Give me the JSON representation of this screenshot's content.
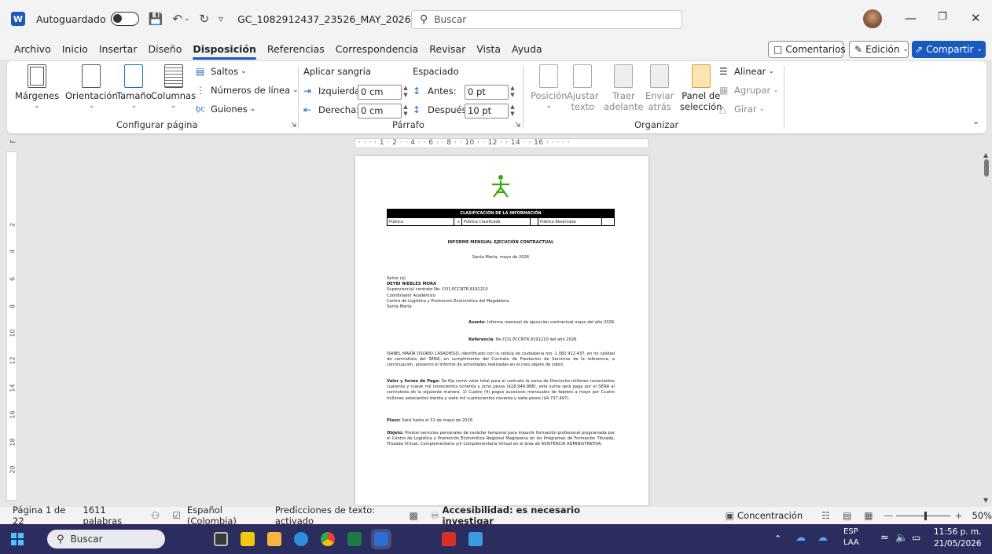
{
  "titlebar": {
    "autosave_label": "Autoguardado",
    "doc_title": "GC_1082912437_23526_MAY_2026....",
    "search_placeholder": "Buscar"
  },
  "menu": {
    "tabs": [
      "Archivo",
      "Inicio",
      "Insertar",
      "Diseño",
      "Disposición",
      "Referencias",
      "Correspondencia",
      "Revisar",
      "Vista",
      "Ayuda"
    ],
    "active_tab": "Disposición",
    "comments_label": "Comentarios",
    "editing_label": "Edición",
    "share_label": "Compartir"
  },
  "ribbon": {
    "page_setup": {
      "margins": "Márgenes",
      "orientation": "Orientación",
      "size": "Tamaño",
      "columns": "Columnas",
      "breaks": "Saltos",
      "line_numbers": "Números de línea",
      "hyphenation": "Guiones",
      "group_label": "Configurar página"
    },
    "paragraph": {
      "indent_label": "Aplicar sangría",
      "left_label": "Izquierda:",
      "left_value": "0 cm",
      "right_label": "Derecha:",
      "right_value": "0 cm",
      "spacing_label": "Espaciado",
      "before_label": "Antes:",
      "before_value": "0 pt",
      "after_label": "Después:",
      "after_value": "10 pt",
      "group_label": "Párrafo"
    },
    "arrange": {
      "position": "Posición",
      "wrap_1": "Ajustar",
      "wrap_2": "texto",
      "forward_1": "Traer",
      "forward_2": "adelante",
      "backward_1": "Enviar",
      "backward_2": "atrás",
      "pane_1": "Panel de",
      "pane_2": "selección",
      "align": "Alinear",
      "group": "Agrupar",
      "rotate": "Girar",
      "group_label": "Organizar"
    }
  },
  "ruler": {
    "h_text": "·  ·  ·  ·  1  ·  2  ·  ·  4  ·  ·  6  ·  ·  8  ·  ·  10  ·  ·  12  ·  ·  14  ·  ·  16  ·  ·  ·  ·  ·",
    "v_labels": [
      "2",
      "4",
      "6",
      "8",
      "10",
      "12",
      "14",
      "16",
      "18",
      "20"
    ]
  },
  "document": {
    "table_header": "CLASIFICACIÓN DE LA INFORMACIÓN",
    "table_cells": [
      "Pública",
      "x",
      "Pública Clasificada",
      "",
      "Pública Reservada",
      ""
    ],
    "heading": "INFORME MENSUAL EJECUCIÓN CONTRACTUAL",
    "place_date": "Santa Marta, mayo de 2026",
    "addressee": [
      "Señor (a)",
      "DEYBI NIEBLES MORA",
      "Supervisor(a) contrato No. CO1.PCCNTR.9191210",
      "Coordinador Académico",
      "Centro de Logística y Promoción Ecoturística del Magdalena",
      "Santa Marta"
    ],
    "subject_label": "Asunto",
    "subject_text": ": Informe mensual de ejecución contractual mayo del año 2026",
    "reference_label": "Referencia",
    "reference_text": ": No CO1.PCCNTR.9191210 del año 2026",
    "intro": "ISABEL MARÍA OSORIO CASADIEGO, identificado con la cédula de ciudadanía nro. 1.082.912.437, en mi calidad de contratista del SENA, en cumplimiento del Contrato de Prestación de Servicios de la referencia, a continuación, presento el Informe de actividades realizadas en el mes objeto de cobro.",
    "payment_label": "Valor y forma de Pago:",
    "payment_text": " Se fija como valor total para el contrato la suma de Dieciocho millones novecientos cuarenta y nueve mil novecientos ochenta y ocho pesos ($18.949.988), esta suma será paga por el SENA al contratista de la siguiente manera: 1) Cuatro (4) pagos sucesivos mensuales de febrero a mayo por Cuatro millones setecientos treinta y siete mil cuatrocientos noventa y siete pesos ($4.737.497).",
    "term_label": "Plazo:",
    "term_text": " Será hasta el 31 de mayo de 2026.",
    "object_label": "Objeto:",
    "object_text": " Prestar servicios personales de carácter temporal para impartir formación profesional programada por el Centro de Logística y Promoción Ecoturística Regional Magdalena en los Programas de Formación Titulada, Titulada Virtual, Complementaria y/o Complementaria Virtual en el área de ASISTENCIA ADMINISTRATIVA."
  },
  "statusbar": {
    "page": "Página 1 de 22",
    "words": "1611 palabras",
    "language": "Español (Colombia)",
    "predictions": "Predicciones de texto: activado",
    "accessibility": "Accesibilidad: es necesario investigar",
    "focus": "Concentración",
    "zoom": "50%"
  },
  "taskbar": {
    "search_label": "Buscar",
    "lang_1": "ESP",
    "lang_2": "LAA",
    "time": "11:56 p. m.",
    "date": "21/05/2026"
  },
  "colors": {
    "accent": "#185abd",
    "taskbar": "#2b2d5e",
    "sena_green": "#39a900"
  }
}
